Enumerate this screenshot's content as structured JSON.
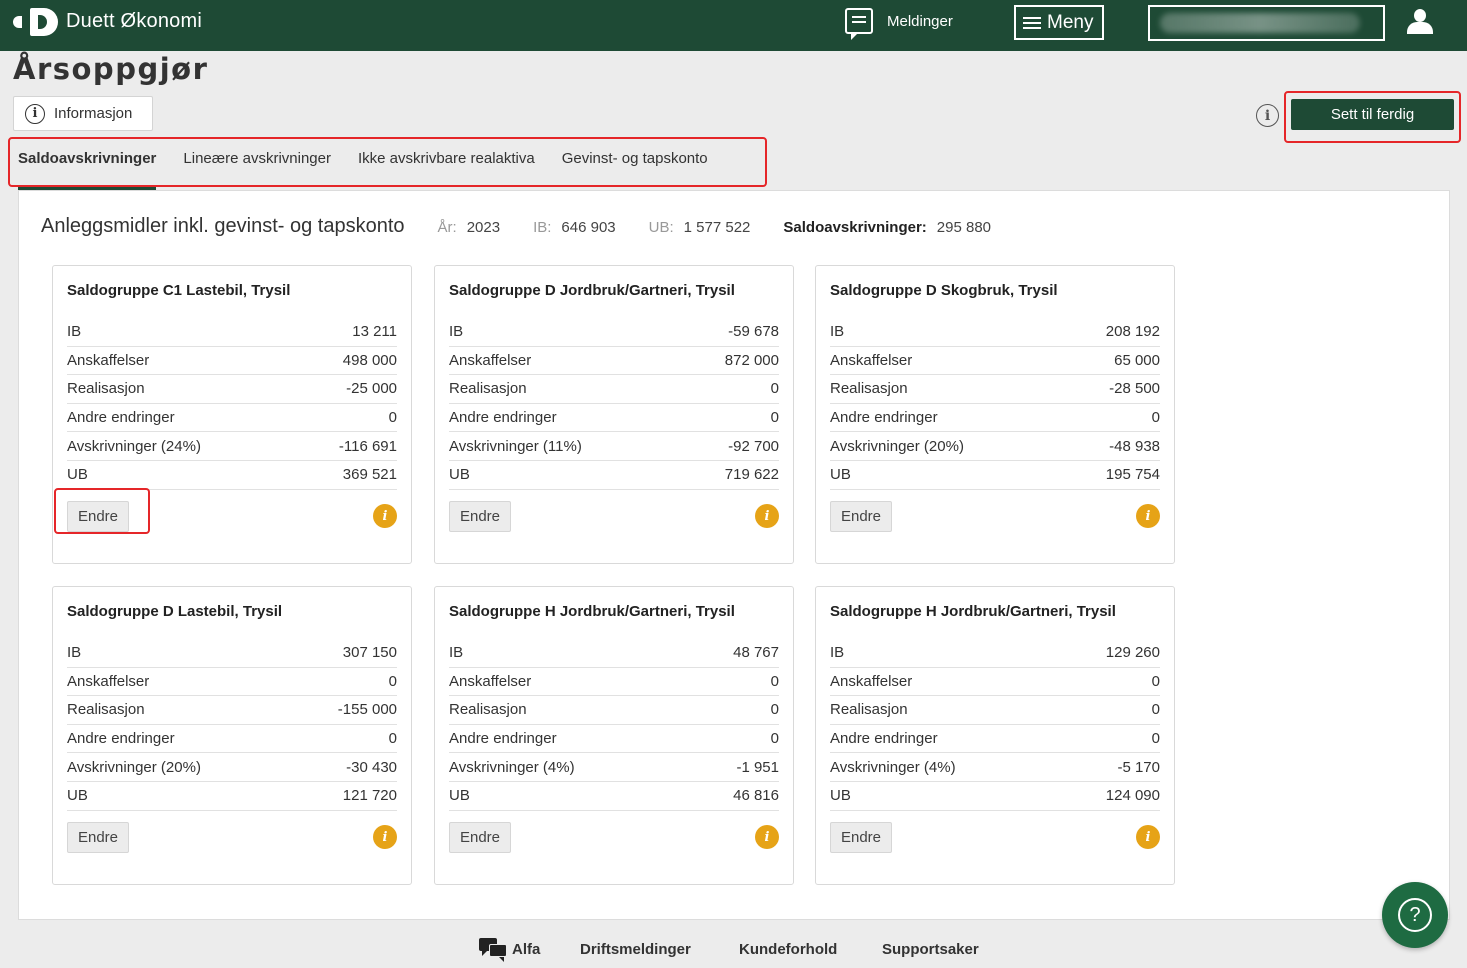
{
  "header": {
    "app_title": "Duett Økonomi",
    "messages_label": "Meldinger",
    "menu_label": "Meny",
    "messages_icon": "message-icon",
    "user_icon": "user-icon"
  },
  "page": {
    "title": "Årsoppgjør",
    "info_button": "Informasjon",
    "done_button": "Sett til ferdig"
  },
  "tabs": [
    {
      "label": "Saldoavskrivninger",
      "active": true
    },
    {
      "label": "Lineære avskrivninger",
      "active": false
    },
    {
      "label": "Ikke avskrivbare realaktiva",
      "active": false
    },
    {
      "label": "Gevinst- og tapskonto",
      "active": false
    }
  ],
  "summary": {
    "heading": "Anleggsmidler inkl. gevinst- og tapskonto",
    "year_label": "År:",
    "year_value": "2023",
    "ib_label": "IB:",
    "ib_value": "646 903",
    "ub_label": "UB:",
    "ub_value": "1 577 522",
    "dep_label": "Saldoavskrivninger:",
    "dep_value": "295 880"
  },
  "cards": [
    {
      "title": "Saldogruppe C1 Lastebil, Trysil",
      "rows": [
        {
          "label": "IB",
          "value": "13 211"
        },
        {
          "label": "Anskaffelser",
          "value": "498 000"
        },
        {
          "label": "Realisasjon",
          "value": "-25 000"
        },
        {
          "label": "Andre endringer",
          "value": "0"
        },
        {
          "label": "Avskrivninger (24%)",
          "value": "-116 691"
        },
        {
          "label": "UB",
          "value": "369 521"
        }
      ],
      "edit_label": "Endre"
    },
    {
      "title": "Saldogruppe D Jordbruk/Gartneri, Trysil",
      "rows": [
        {
          "label": "IB",
          "value": "-59 678"
        },
        {
          "label": "Anskaffelser",
          "value": "872 000"
        },
        {
          "label": "Realisasjon",
          "value": "0"
        },
        {
          "label": "Andre endringer",
          "value": "0"
        },
        {
          "label": "Avskrivninger (11%)",
          "value": "-92 700"
        },
        {
          "label": "UB",
          "value": "719 622"
        }
      ],
      "edit_label": "Endre"
    },
    {
      "title": "Saldogruppe D Skogbruk, Trysil",
      "rows": [
        {
          "label": "IB",
          "value": "208 192"
        },
        {
          "label": "Anskaffelser",
          "value": "65 000"
        },
        {
          "label": "Realisasjon",
          "value": "-28 500"
        },
        {
          "label": "Andre endringer",
          "value": "0"
        },
        {
          "label": "Avskrivninger (20%)",
          "value": "-48 938"
        },
        {
          "label": "UB",
          "value": "195 754"
        }
      ],
      "edit_label": "Endre"
    },
    {
      "title": "Saldogruppe D Lastebil, Trysil",
      "rows": [
        {
          "label": "IB",
          "value": "307 150"
        },
        {
          "label": "Anskaffelser",
          "value": "0"
        },
        {
          "label": "Realisasjon",
          "value": "-155 000"
        },
        {
          "label": "Andre endringer",
          "value": "0"
        },
        {
          "label": "Avskrivninger (20%)",
          "value": "-30 430"
        },
        {
          "label": "UB",
          "value": "121 720"
        }
      ],
      "edit_label": "Endre"
    },
    {
      "title": "Saldogruppe H Jordbruk/Gartneri, Trysil",
      "rows": [
        {
          "label": "IB",
          "value": "48 767"
        },
        {
          "label": "Anskaffelser",
          "value": "0"
        },
        {
          "label": "Realisasjon",
          "value": "0"
        },
        {
          "label": "Andre endringer",
          "value": "0"
        },
        {
          "label": "Avskrivninger (4%)",
          "value": "-1 951"
        },
        {
          "label": "UB",
          "value": "46 816"
        }
      ],
      "edit_label": "Endre"
    },
    {
      "title": "Saldogruppe H Jordbruk/Gartneri, Trysil",
      "rows": [
        {
          "label": "IB",
          "value": "129 260"
        },
        {
          "label": "Anskaffelser",
          "value": "0"
        },
        {
          "label": "Realisasjon",
          "value": "0"
        },
        {
          "label": "Andre endringer",
          "value": "0"
        },
        {
          "label": "Avskrivninger (4%)",
          "value": "-5 170"
        },
        {
          "label": "UB",
          "value": "124 090"
        }
      ],
      "edit_label": "Endre"
    }
  ],
  "footer": {
    "alfa": "Alfa",
    "driftsmeldinger": "Driftsmeldinger",
    "kundeforhold": "Kundeforhold",
    "supportsaker": "Supportsaker"
  },
  "colors": {
    "brand": "#1e4a35",
    "highlight": "#e52629",
    "warning": "#e6a317",
    "help": "#1e6b42"
  }
}
